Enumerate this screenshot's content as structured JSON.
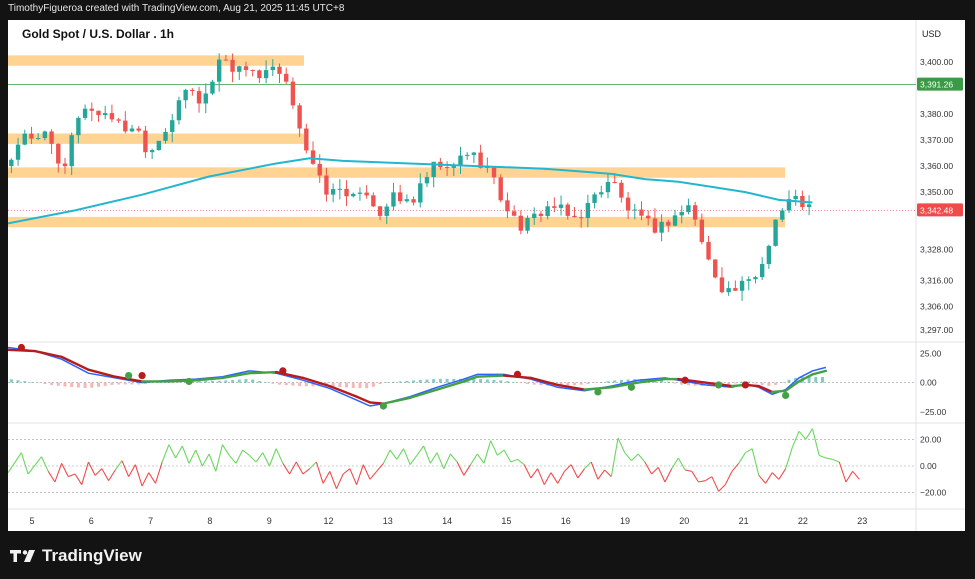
{
  "header": {
    "attribution": "TimothyFigueroa created with TradingView.com, Aug 21, 2025 11:45 UTC+8"
  },
  "footer": {
    "brand": "TradingView"
  },
  "colors": {
    "up": "#26a69a",
    "down": "#ef5350",
    "ma": "#22b7d0",
    "zone": "#ffcc80",
    "ind_up": "#43a047",
    "ind_down": "#b71c1c",
    "rsi_up": "#6bd75f",
    "rsi_down": "#ef4b4b",
    "axis_text": "#333333",
    "price_tag": "#ef4b4b",
    "level_tag": "#3a9a45"
  },
  "chart_data": [
    {
      "type": "candlestick",
      "title": "Gold Spot / U.S. Dollar . 1h",
      "currency": "USD",
      "y_ticks": [
        3400,
        3380,
        3370,
        3360,
        3350,
        3328,
        3316,
        3306,
        3297
      ],
      "ylim": [
        3294,
        3413
      ],
      "x_ticks": [
        "5",
        "6",
        "7",
        "8",
        "9",
        "12",
        "13",
        "14",
        "15",
        "16",
        "19",
        "20",
        "21",
        "22",
        "23"
      ],
      "last_price_label": "3,342.48",
      "horizontal_line": {
        "value": 3391.26,
        "label": "3,391.26"
      },
      "zones": [
        {
          "from": 3398.5,
          "to": 3402.5
        },
        {
          "from": 3368.5,
          "to": 3372.5
        },
        {
          "from": 3355.5,
          "to": 3359.5
        },
        {
          "from": 3336.5,
          "to": 3340.5
        }
      ],
      "price_path": [
        [
          0,
          3360
        ],
        [
          2,
          3372
        ],
        [
          4,
          3368
        ],
        [
          6,
          3376
        ],
        [
          7,
          3365
        ],
        [
          8,
          3352
        ],
        [
          9,
          3366
        ],
        [
          11,
          3384
        ],
        [
          13,
          3380
        ],
        [
          15,
          3381
        ],
        [
          17,
          3374
        ],
        [
          19,
          3376
        ],
        [
          21,
          3365
        ],
        [
          23,
          3373
        ],
        [
          25,
          3380
        ],
        [
          27,
          3392
        ],
        [
          28,
          3384
        ],
        [
          30,
          3389
        ],
        [
          32,
          3404
        ],
        [
          34,
          3396
        ],
        [
          36,
          3399
        ],
        [
          38,
          3392
        ],
        [
          39,
          3398
        ],
        [
          41,
          3393
        ],
        [
          43,
          3382
        ],
        [
          44,
          3370
        ],
        [
          46,
          3356
        ],
        [
          48,
          3349
        ],
        [
          50,
          3352
        ],
        [
          52,
          3346
        ],
        [
          54,
          3352
        ],
        [
          55,
          3340
        ],
        [
          57,
          3348
        ],
        [
          59,
          3346
        ],
        [
          61,
          3348
        ],
        [
          62,
          3354
        ],
        [
          64,
          3361
        ],
        [
          66,
          3357
        ],
        [
          68,
          3366
        ],
        [
          70,
          3363
        ],
        [
          72,
          3358
        ],
        [
          73,
          3350
        ],
        [
          75,
          3342
        ],
        [
          76,
          3337
        ],
        [
          78,
          3338
        ],
        [
          79,
          3342
        ],
        [
          81,
          3345
        ],
        [
          83,
          3342
        ],
        [
          84,
          3339
        ],
        [
          86,
          3343
        ],
        [
          88,
          3350
        ],
        [
          90,
          3356
        ],
        [
          91,
          3349
        ],
        [
          93,
          3342
        ],
        [
          95,
          3338
        ],
        [
          97,
          3336
        ],
        [
          99,
          3340
        ],
        [
          100,
          3342
        ],
        [
          102,
          3345
        ],
        [
          103,
          3335
        ],
        [
          104,
          3326
        ],
        [
          106,
          3316
        ],
        [
          107,
          3312
        ],
        [
          109,
          3313
        ],
        [
          111,
          3316
        ],
        [
          113,
          3325
        ],
        [
          114,
          3338
        ],
        [
          116,
          3345
        ],
        [
          117,
          3348
        ],
        [
          119,
          3345
        ],
        [
          120,
          3343
        ]
      ],
      "ma_path": [
        [
          0,
          3338
        ],
        [
          10,
          3343
        ],
        [
          20,
          3349
        ],
        [
          30,
          3356
        ],
        [
          40,
          3361
        ],
        [
          45,
          3363
        ],
        [
          50,
          3362
        ],
        [
          60,
          3361
        ],
        [
          70,
          3360
        ],
        [
          80,
          3359
        ],
        [
          85,
          3358
        ],
        [
          90,
          3357
        ],
        [
          95,
          3355
        ],
        [
          100,
          3354
        ],
        [
          105,
          3352
        ],
        [
          110,
          3350
        ],
        [
          115,
          3347
        ],
        [
          120,
          3346
        ]
      ],
      "x_range": [
        0,
        135
      ]
    },
    {
      "type": "line",
      "y_ticks": [
        25.0,
        0.0,
        -25.0
      ],
      "y_tick_labels": [
        "25.00",
        "0.00",
        "−25.00"
      ],
      "ylim": [
        -32,
        33
      ],
      "x_range": [
        0,
        135
      ],
      "fast_line": [
        [
          0,
          30
        ],
        [
          4,
          27
        ],
        [
          8,
          20
        ],
        [
          12,
          8
        ],
        [
          16,
          4
        ],
        [
          20,
          0
        ],
        [
          24,
          2
        ],
        [
          28,
          3
        ],
        [
          32,
          5
        ],
        [
          36,
          10
        ],
        [
          40,
          8
        ],
        [
          44,
          2
        ],
        [
          48,
          -5
        ],
        [
          52,
          -15
        ],
        [
          54,
          -20
        ],
        [
          56,
          -18
        ],
        [
          60,
          -12
        ],
        [
          64,
          -4
        ],
        [
          68,
          3
        ],
        [
          70,
          7
        ],
        [
          74,
          7
        ],
        [
          78,
          3
        ],
        [
          82,
          -4
        ],
        [
          86,
          -7
        ],
        [
          90,
          -3
        ],
        [
          94,
          2
        ],
        [
          98,
          4
        ],
        [
          100,
          2
        ],
        [
          104,
          -2
        ],
        [
          108,
          -4
        ],
        [
          110,
          -1
        ],
        [
          112,
          -4
        ],
        [
          114,
          -10
        ],
        [
          116,
          -6
        ],
        [
          118,
          4
        ],
        [
          120,
          10
        ],
        [
          122,
          13
        ]
      ],
      "slow_line": [
        [
          0,
          28
        ],
        [
          4,
          27
        ],
        [
          8,
          22
        ],
        [
          12,
          11
        ],
        [
          16,
          5
        ],
        [
          20,
          1
        ],
        [
          24,
          1
        ],
        [
          28,
          2
        ],
        [
          32,
          4
        ],
        [
          36,
          8
        ],
        [
          40,
          9
        ],
        [
          44,
          4
        ],
        [
          48,
          -3
        ],
        [
          52,
          -12
        ],
        [
          54,
          -17
        ],
        [
          56,
          -18
        ],
        [
          60,
          -13
        ],
        [
          64,
          -6
        ],
        [
          68,
          1
        ],
        [
          70,
          5
        ],
        [
          74,
          6
        ],
        [
          78,
          4
        ],
        [
          82,
          -2
        ],
        [
          86,
          -6
        ],
        [
          90,
          -4
        ],
        [
          94,
          0
        ],
        [
          98,
          3
        ],
        [
          100,
          3
        ],
        [
          104,
          0
        ],
        [
          108,
          -3
        ],
        [
          110,
          -2
        ],
        [
          112,
          -3
        ],
        [
          114,
          -8
        ],
        [
          116,
          -7
        ],
        [
          118,
          1
        ],
        [
          120,
          7
        ],
        [
          122,
          10
        ]
      ],
      "cross_up": [
        [
          18,
          6
        ],
        [
          27,
          1
        ],
        [
          56,
          -20
        ],
        [
          88,
          -8
        ],
        [
          93,
          -4
        ],
        [
          106,
          -2
        ],
        [
          116,
          -11
        ]
      ],
      "cross_down": [
        [
          2,
          30
        ],
        [
          20,
          6
        ],
        [
          41,
          10
        ],
        [
          76,
          7
        ],
        [
          101,
          2
        ],
        [
          110,
          -2
        ]
      ]
    },
    {
      "type": "line",
      "y_ticks": [
        20.0,
        0.0,
        -20.0
      ],
      "y_tick_labels": [
        "20.00",
        "0.00",
        "−20.00"
      ],
      "ylim": [
        -27,
        30
      ],
      "x_range": [
        0,
        135
      ],
      "oscillator": [
        [
          0,
          -5
        ],
        [
          2,
          10
        ],
        [
          3,
          -6
        ],
        [
          5,
          7
        ],
        [
          6,
          -4
        ],
        [
          7,
          -12
        ],
        [
          8,
          2
        ],
        [
          9,
          -8
        ],
        [
          10,
          -6
        ],
        [
          11,
          -14
        ],
        [
          12,
          3
        ],
        [
          13,
          -7
        ],
        [
          14,
          -2
        ],
        [
          15,
          -11
        ],
        [
          16,
          -3
        ],
        [
          17,
          4
        ],
        [
          18,
          -8
        ],
        [
          19,
          1
        ],
        [
          20,
          -15
        ],
        [
          21,
          -5
        ],
        [
          22,
          -13
        ],
        [
          23,
          3
        ],
        [
          24,
          16
        ],
        [
          25,
          6
        ],
        [
          26,
          15
        ],
        [
          27,
          2
        ],
        [
          28,
          12
        ],
        [
          29,
          0
        ],
        [
          30,
          9
        ],
        [
          31,
          -4
        ],
        [
          32,
          16
        ],
        [
          33,
          8
        ],
        [
          34,
          2
        ],
        [
          35,
          12
        ],
        [
          36,
          8
        ],
        [
          37,
          3
        ],
        [
          38,
          10
        ],
        [
          39,
          0
        ],
        [
          40,
          13
        ],
        [
          41,
          2
        ],
        [
          42,
          -6
        ],
        [
          43,
          3
        ],
        [
          44,
          -6
        ],
        [
          45,
          -2
        ],
        [
          46,
          3
        ],
        [
          47,
          -13
        ],
        [
          48,
          -4
        ],
        [
          49,
          -17
        ],
        [
          50,
          -6
        ],
        [
          51,
          -2
        ],
        [
          52,
          -14
        ],
        [
          53,
          1
        ],
        [
          54,
          -10
        ],
        [
          55,
          -4
        ],
        [
          56,
          2
        ],
        [
          57,
          12
        ],
        [
          58,
          5
        ],
        [
          59,
          13
        ],
        [
          60,
          1
        ],
        [
          61,
          8
        ],
        [
          62,
          15
        ],
        [
          63,
          2
        ],
        [
          64,
          10
        ],
        [
          65,
          -2
        ],
        [
          66,
          9
        ],
        [
          67,
          3
        ],
        [
          68,
          -7
        ],
        [
          69,
          1
        ],
        [
          70,
          9
        ],
        [
          71,
          2
        ],
        [
          72,
          19
        ],
        [
          73,
          8
        ],
        [
          74,
          12
        ],
        [
          75,
          3
        ],
        [
          76,
          5
        ],
        [
          77,
          1
        ],
        [
          78,
          -9
        ],
        [
          79,
          -2
        ],
        [
          80,
          -14
        ],
        [
          81,
          -5
        ],
        [
          82,
          -13
        ],
        [
          83,
          -4
        ],
        [
          84,
          1
        ],
        [
          85,
          -9
        ],
        [
          86,
          -2
        ],
        [
          87,
          3
        ],
        [
          88,
          -10
        ],
        [
          89,
          -3
        ],
        [
          90,
          -8
        ],
        [
          91,
          21
        ],
        [
          92,
          10
        ],
        [
          93,
          4
        ],
        [
          94,
          9
        ],
        [
          95,
          3
        ],
        [
          96,
          -6
        ],
        [
          97,
          -1
        ],
        [
          98,
          -12
        ],
        [
          99,
          -2
        ],
        [
          100,
          6
        ],
        [
          101,
          -3
        ],
        [
          102,
          -4
        ],
        [
          103,
          -12
        ],
        [
          104,
          -11
        ],
        [
          105,
          -8
        ],
        [
          106,
          -19
        ],
        [
          107,
          -14
        ],
        [
          108,
          -4
        ],
        [
          109,
          2
        ],
        [
          110,
          10
        ],
        [
          111,
          13
        ],
        [
          112,
          -7
        ],
        [
          113,
          -13
        ],
        [
          114,
          -5
        ],
        [
          115,
          -10
        ],
        [
          116,
          -2
        ],
        [
          117,
          14
        ],
        [
          118,
          26
        ],
        [
          119,
          20
        ],
        [
          120,
          28
        ],
        [
          121,
          8
        ],
        [
          122,
          6
        ],
        [
          123,
          5
        ],
        [
          124,
          3
        ],
        [
          125,
          -12
        ],
        [
          126,
          -4
        ],
        [
          127,
          -10
        ]
      ]
    }
  ]
}
